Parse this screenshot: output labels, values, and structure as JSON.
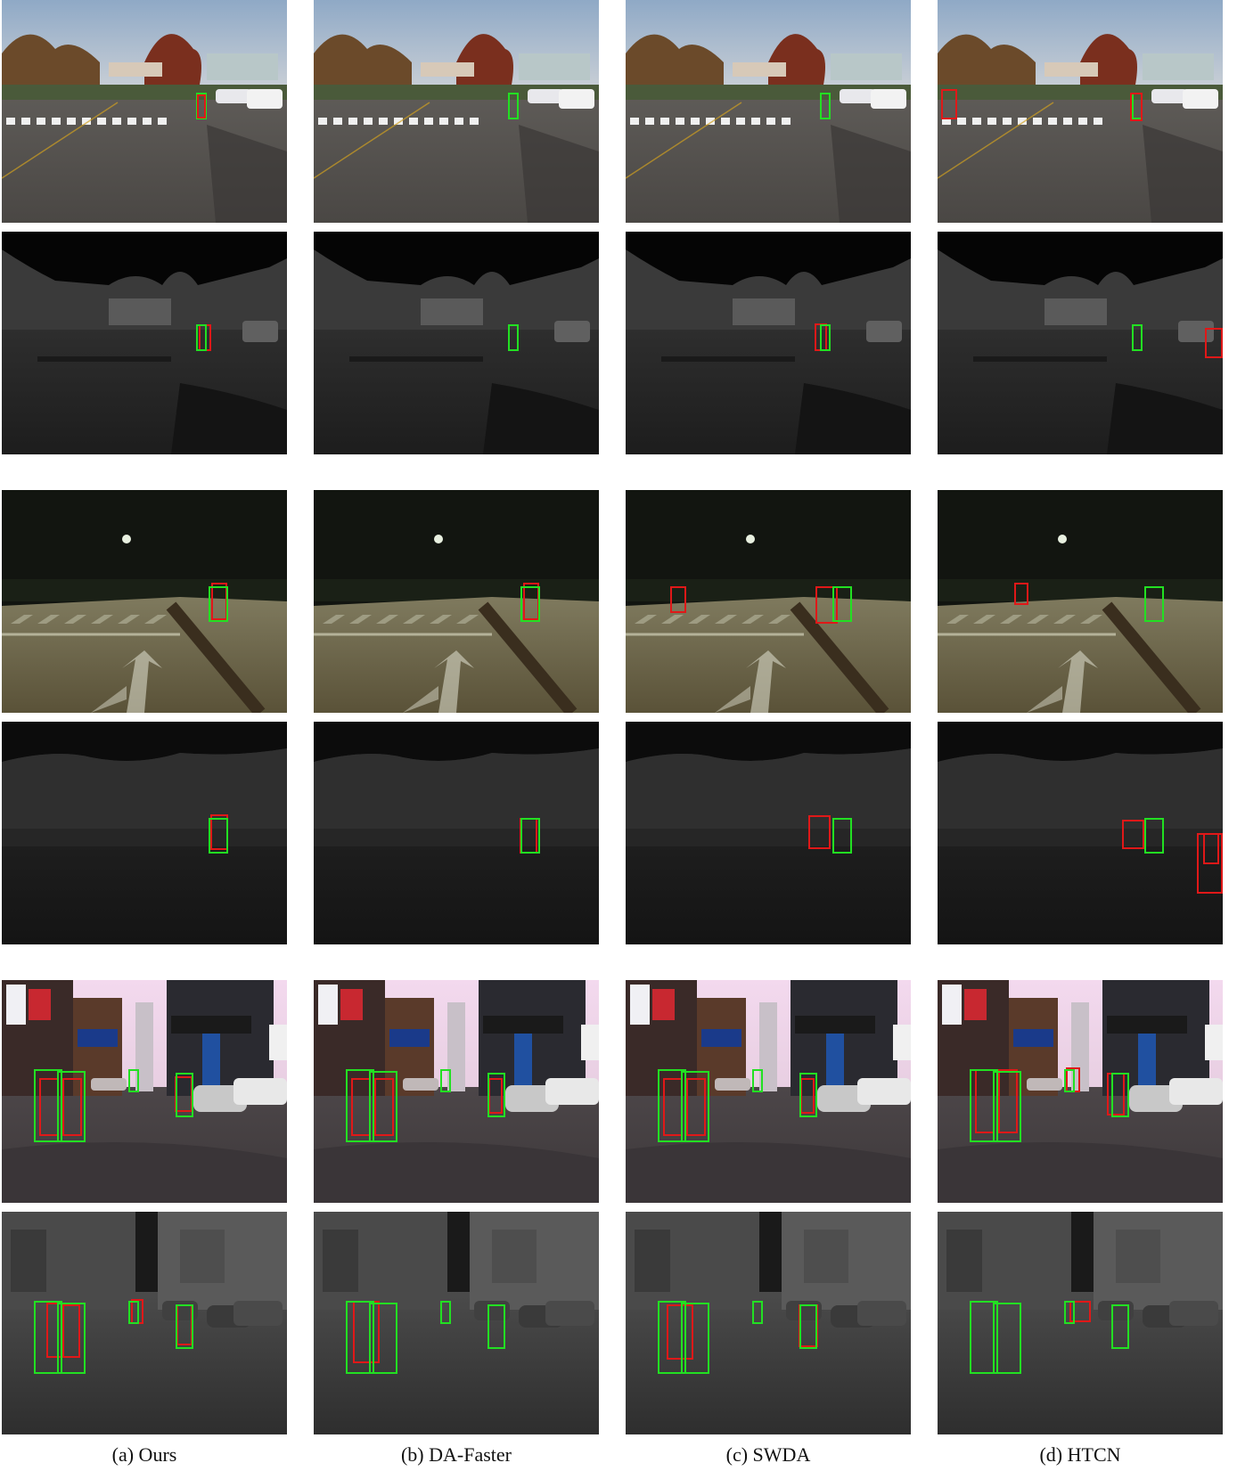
{
  "figure": {
    "columns": [
      {
        "caption": "(a) Ours"
      },
      {
        "caption": "(b) DA-Faster"
      },
      {
        "caption": "(c) SWDA"
      },
      {
        "caption": "(d) HTCN"
      }
    ],
    "rows": [
      {
        "scene": "day-campus-road",
        "modality": "rgb"
      },
      {
        "scene": "day-campus-road",
        "modality": "thermal"
      },
      {
        "scene": "night-crosswalk",
        "modality": "rgb"
      },
      {
        "scene": "night-crosswalk",
        "modality": "thermal"
      },
      {
        "scene": "city-street",
        "modality": "rgb"
      },
      {
        "scene": "city-street",
        "modality": "thermal"
      }
    ],
    "box_colors": {
      "ground_truth": "#22e022",
      "prediction": "#e01818"
    }
  }
}
